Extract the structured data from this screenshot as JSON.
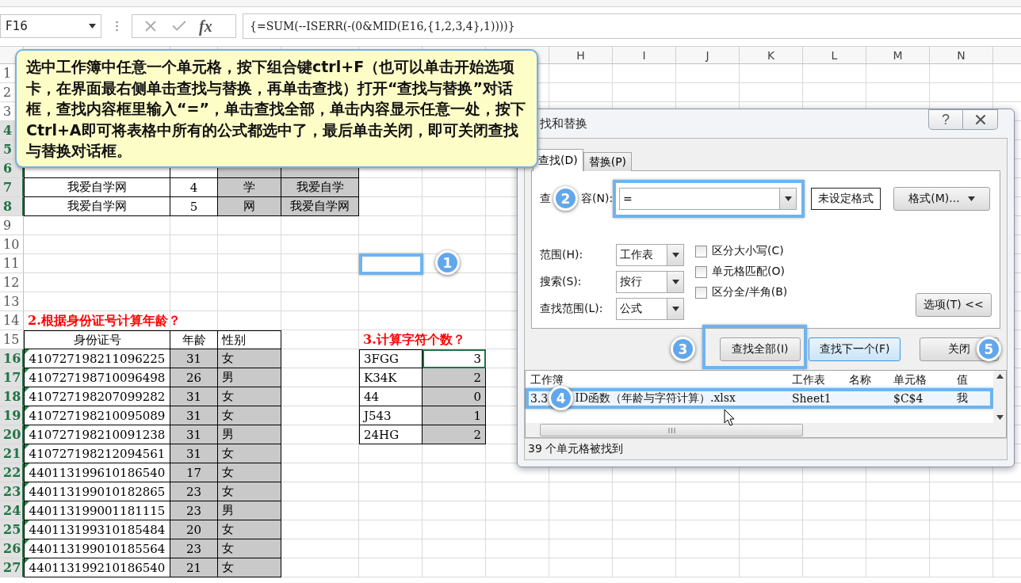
{
  "formula_bar": {
    "name_box": "F16",
    "function_label": "fx",
    "formula": "{=SUM(--ISERR(-(0&MID(E16,{1,2,3,4},1))))}"
  },
  "sheet": {
    "column_headers": [
      "H",
      "I",
      "J",
      "K",
      "L",
      "M",
      "N"
    ],
    "row_headers": [
      {
        "label": "1",
        "selected": false
      },
      {
        "label": "2",
        "selected": false
      },
      {
        "label": "3",
        "selected": false
      },
      {
        "label": "4",
        "selected": true
      },
      {
        "label": "5",
        "selected": true
      },
      {
        "label": "6",
        "selected": true
      },
      {
        "label": "7",
        "selected": true
      },
      {
        "label": "8",
        "selected": true
      },
      {
        "label": "9",
        "selected": false
      },
      {
        "label": "10",
        "selected": false
      },
      {
        "label": "11",
        "selected": false
      },
      {
        "label": "12",
        "selected": false
      },
      {
        "label": "13",
        "selected": false
      },
      {
        "label": "14",
        "selected": false
      },
      {
        "label": "15",
        "selected": false
      },
      {
        "label": "16",
        "selected": true
      },
      {
        "label": "17",
        "selected": true
      },
      {
        "label": "18",
        "selected": true
      },
      {
        "label": "19",
        "selected": true
      },
      {
        "label": "20",
        "selected": true
      },
      {
        "label": "21",
        "selected": true
      },
      {
        "label": "22",
        "selected": true
      },
      {
        "label": "23",
        "selected": true
      },
      {
        "label": "24",
        "selected": true
      },
      {
        "label": "25",
        "selected": true
      },
      {
        "label": "26",
        "selected": true
      },
      {
        "label": "27",
        "selected": true
      }
    ],
    "table_1": [
      {
        "cells": [
          "我爱自学网",
          "4",
          "学",
          "我爱自学"
        ]
      },
      {
        "cells": [
          "我爱自学网",
          "5",
          "网",
          "我爱自学网"
        ]
      }
    ],
    "step_marker": "1",
    "section_2": {
      "title": "2.根据身份证号计算年龄？",
      "columns": [
        "身份证号",
        "年龄",
        "性别"
      ],
      "rows": [
        {
          "id": "410727198211096225",
          "age": "31",
          "gender": "女"
        },
        {
          "id": "410727198710096498",
          "age": "26",
          "gender": "男"
        },
        {
          "id": "410727198207099282",
          "age": "31",
          "gender": "女"
        },
        {
          "id": "410727198210095089",
          "age": "31",
          "gender": "女"
        },
        {
          "id": "410727198210091238",
          "age": "31",
          "gender": "男"
        },
        {
          "id": "410727198212094561",
          "age": "31",
          "gender": "女"
        },
        {
          "id": "440113199610186540",
          "age": "17",
          "gender": "女"
        },
        {
          "id": "440113199010182865",
          "age": "23",
          "gender": "女"
        },
        {
          "id": "440113199001181115",
          "age": "23",
          "gender": "男"
        },
        {
          "id": "440113199310185484",
          "age": "20",
          "gender": "女"
        },
        {
          "id": "440113199010185564",
          "age": "23",
          "gender": "女"
        },
        {
          "id": "440113199210186540",
          "age": "21",
          "gender": "女"
        }
      ]
    },
    "section_3": {
      "title": "3.计算字符个数？",
      "rows": [
        {
          "text": "3FGG",
          "count": "3",
          "selected": true
        },
        {
          "text": "K34K",
          "count": "2",
          "selected": false
        },
        {
          "text": "44",
          "count": "0",
          "selected": false
        },
        {
          "text": "J543",
          "count": "1",
          "selected": false
        },
        {
          "text": "24HG",
          "count": "2",
          "selected": false
        }
      ]
    }
  },
  "callout": {
    "text": "选中工作簿中任意一个单元格，按下组合键ctrl+F（也可以单击开始选项卡，在界面最右侧单击查找与替换，再单击查找）打开“查找与替换”对话框，查找内容框里输入“=”，单击查找全部，单击内容显示任意一处，按下Ctrl+A即可将表格中所有的公式都选中了，最后单击关闭，即可关闭查找与替换对话框。"
  },
  "dialog": {
    "title": "找和替换",
    "help": "?",
    "tabs": [
      {
        "label": "查找(D)",
        "selected": true
      },
      {
        "label": "替换(P)",
        "selected": false
      }
    ],
    "find": {
      "label_parts": [
        "查",
        "容(N):"
      ],
      "value": "=",
      "step_marker": "2",
      "format_status": "未设定格式",
      "format_button": "格式(M)..."
    },
    "options": [
      {
        "label": "范围(H):",
        "value": "工作表"
      },
      {
        "label": "搜索(S):",
        "value": "按行"
      },
      {
        "label": "查找范围(L):",
        "value": "公式"
      }
    ],
    "checkboxes": [
      {
        "label": "区分大小写(C)",
        "checked": false
      },
      {
        "label": "单元格匹配(O)",
        "checked": false
      },
      {
        "label": "区分全/半角(B)",
        "checked": false
      }
    ],
    "options_button": "选项(T) <<",
    "buttons": [
      {
        "label": "查找全部(I)",
        "kind": "highlighted",
        "step_marker": "3"
      },
      {
        "label": "查找下一个(F)",
        "kind": "focused"
      },
      {
        "label": "关闭",
        "kind": "plain",
        "step_marker": "5"
      }
    ],
    "results": {
      "columns": [
        "工作簿",
        "工作表",
        "名称",
        "单元格",
        "值"
      ],
      "rows": [
        {
          "workbook_parts": [
            "3.3",
            "ID函数（年龄与字符计算）.xlsx"
          ],
          "sheet": "Sheet1",
          "cell": "$C$4",
          "value": "我",
          "selected": true,
          "step_marker": "4"
        }
      ]
    },
    "status": "39 个单元格被找到"
  }
}
